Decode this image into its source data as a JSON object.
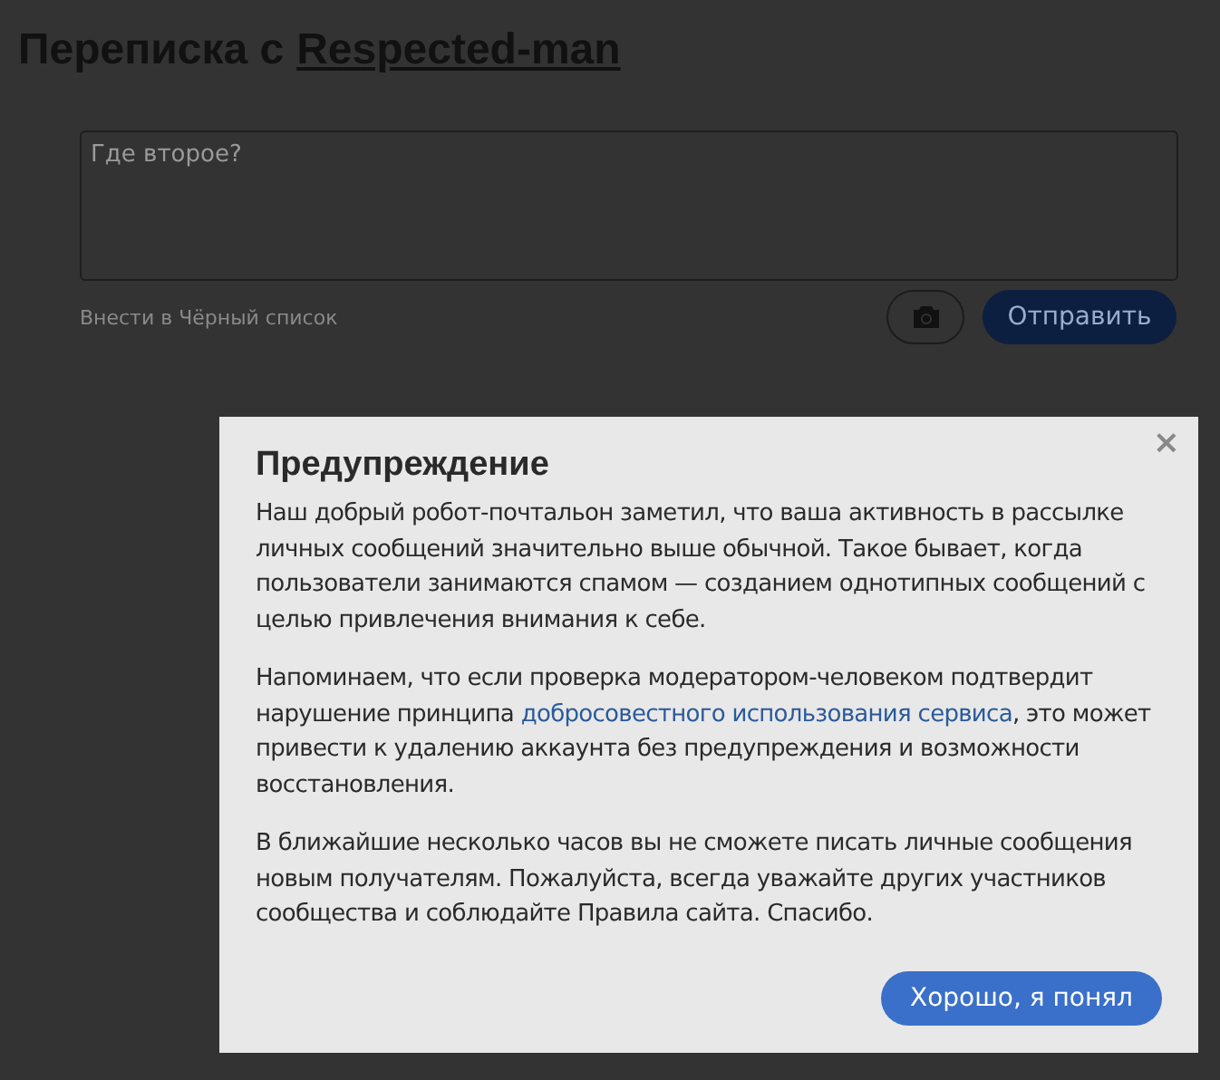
{
  "page": {
    "title_prefix": "Переписка с",
    "title_user": "Respected-man"
  },
  "composer": {
    "message": "Где второе?",
    "blacklist_link": "Внести в Чёрный список",
    "send_button": "Отправить"
  },
  "dialog": {
    "title": "Предупреждение",
    "close": "×",
    "paragraphs": [
      [
        {
          "kind": "text",
          "text": "Наш добрый робот-почтальон заметил, что ваша активность в рассылке личных сообщений значительно выше обычной. Такое бывает, когда пользователи занимаются спамом — созданием однотипных сообщений с целью привлечения внимания к себе."
        }
      ],
      [
        {
          "kind": "text",
          "text": "Напоминаем, что если проверка модератором-человеком подтвердит нарушение принципа "
        },
        {
          "kind": "link",
          "text": "добросовестного использования сервиса"
        },
        {
          "kind": "text",
          "text": ", это может привести к удалению аккаунта без предупреждения и возможности восстановления."
        }
      ],
      [
        {
          "kind": "text",
          "text": "В ближайшие несколько часов вы не сможете писать личные сообщения новым получателям. Пожалуйста, всегда уважайте других участников сообщества и соблюдайте Правила сайта. Спасибо."
        }
      ]
    ],
    "ok_button": "Хорошо, я понял"
  }
}
